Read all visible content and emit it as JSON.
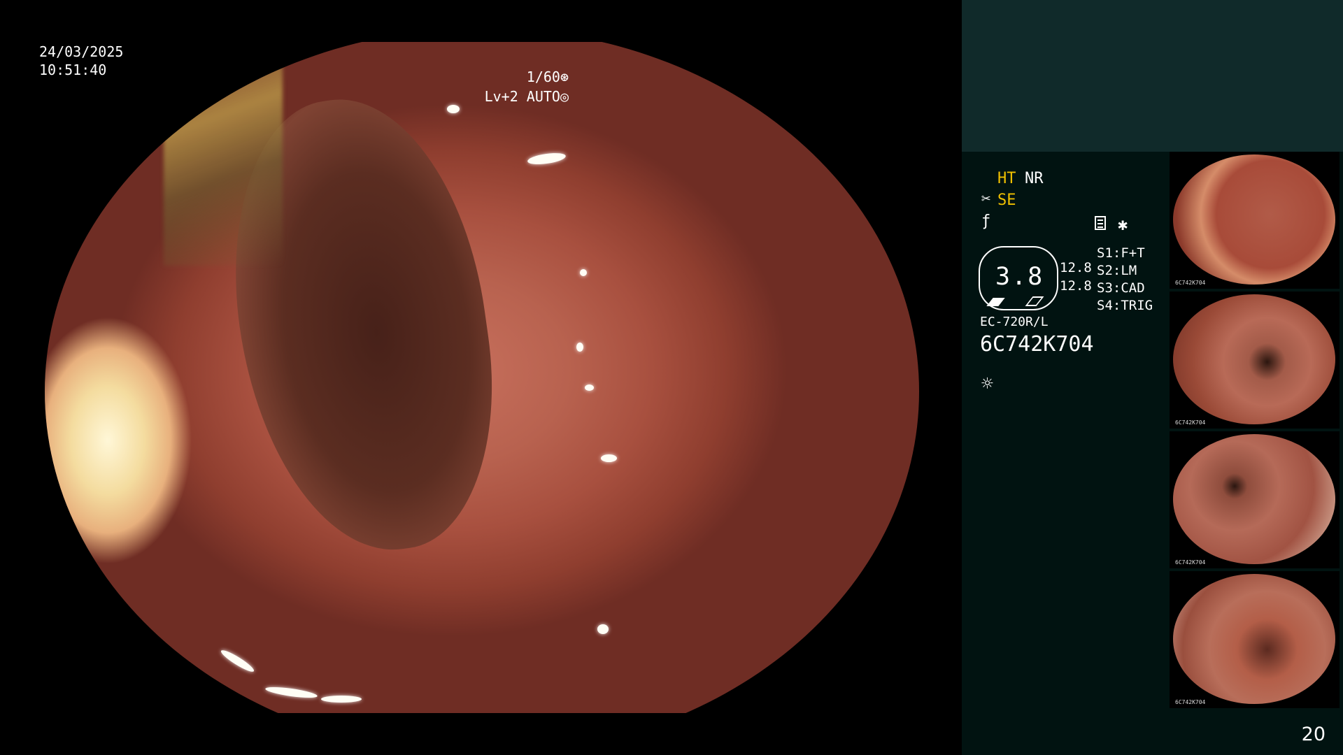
{
  "overlay": {
    "date": "24/03/2025",
    "time": "10:51:40",
    "shutter": "1/60⊛",
    "level": "Lv+2 AUTO◎"
  },
  "panel": {
    "mode_ht": "HT",
    "mode_nr": "NR",
    "mode_se": "SE",
    "magnification": "3.8",
    "value_1": "12.8",
    "value_2": "12.8",
    "s1": "S1:F+T",
    "s2": "S2:LM",
    "s3": "S3:CAD",
    "s4": "S4:TRIG",
    "scope_model": "EC-720R/L",
    "serial": "6C742K704",
    "page_number": "20"
  },
  "thumbnails": [
    {
      "label": "6C742K704"
    },
    {
      "label": "6C742K704"
    },
    {
      "label": "6C742K704"
    },
    {
      "label": "6C742K704"
    }
  ],
  "icons": {
    "mode_se": "scissor-icon",
    "mode_f": "f-slash-icon",
    "document": "document-icon",
    "asterisk": "asterisk-icon",
    "light": "sun-icon",
    "shutter": "shutter-icon",
    "auto": "auto-icon"
  }
}
